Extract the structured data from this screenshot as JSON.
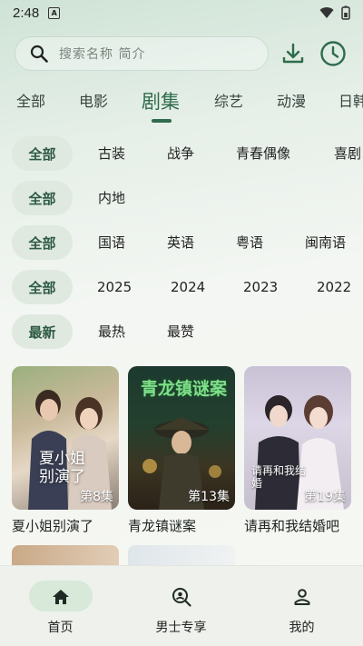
{
  "status_bar": {
    "time": "2:48",
    "sim_label": "A"
  },
  "search": {
    "placeholder": "搜索名称 简介"
  },
  "tabs": [
    {
      "label": "全部"
    },
    {
      "label": "电影"
    },
    {
      "label": "剧集"
    },
    {
      "label": "综艺"
    },
    {
      "label": "动漫"
    },
    {
      "label": "日韩"
    }
  ],
  "active_tab": "剧集",
  "filters": [
    {
      "selected": "全部",
      "options": [
        "古装",
        "战争",
        "青春偶像",
        "喜剧"
      ]
    },
    {
      "selected": "全部",
      "options": [
        "内地"
      ]
    },
    {
      "selected": "全部",
      "options": [
        "国语",
        "英语",
        "粤语",
        "闽南语"
      ]
    },
    {
      "selected": "全部",
      "options": [
        "2025",
        "2024",
        "2023",
        "2022"
      ]
    },
    {
      "selected": "最新",
      "options": [
        "最热",
        "最赞"
      ]
    }
  ],
  "cards": [
    {
      "title": "夏小姐别演了",
      "episode": "第8集",
      "poster_text": "夏小姐别演了"
    },
    {
      "title": "青龙镇谜案",
      "episode": "第13集",
      "poster_text": "青龙镇谜案"
    },
    {
      "title": "请再和我结婚吧",
      "episode": "第19集",
      "poster_text": "请再和我结婚"
    }
  ],
  "bottom_nav": [
    {
      "label": "首页",
      "icon": "home-icon",
      "active": true
    },
    {
      "label": "男士专享",
      "icon": "search-person-icon",
      "active": false
    },
    {
      "label": "我的",
      "icon": "person-icon",
      "active": false
    }
  ],
  "colors": {
    "accent": "#2f6b4c",
    "chip_bg": "#dfe9e0",
    "nav_active_bg": "#d8e8d9"
  }
}
